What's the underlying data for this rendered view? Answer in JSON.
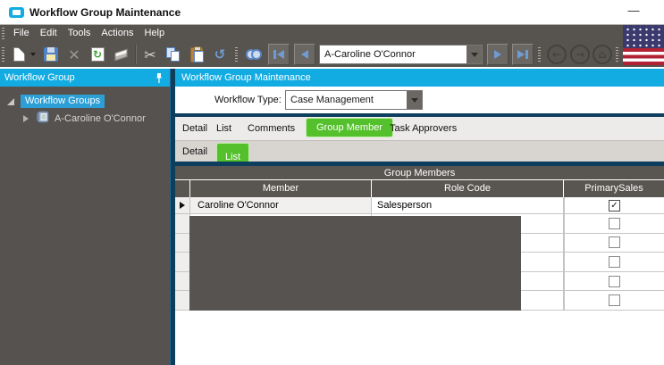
{
  "colors": {
    "accent_cyan": "#12ACE3",
    "selected_green": "#54C02B",
    "bar_dark_gray": "#57534E",
    "panel_dark_gray": "#555250",
    "splitter_navy": "#0E3E5E",
    "grid_header_gray": "#595551",
    "flag_blue": "#3A3A6E",
    "flag_red": "#B22234"
  },
  "window": {
    "title": "Workflow Group Maintenance",
    "minimize_glyph": "—"
  },
  "menu_bar": {
    "items": [
      "File",
      "Edit",
      "Tools",
      "Actions",
      "Help"
    ]
  },
  "toolbar": {
    "record_combo_value": "A-Caroline O'Connor",
    "icons": [
      "new-icon",
      "new-dropdown-icon",
      "save-icon",
      "delete-icon",
      "refresh-icon",
      "erase-icon",
      "cut-icon",
      "copy-icon",
      "paste-icon",
      "undo-icon",
      "find-icon",
      "first-record-icon",
      "previous-record-icon",
      "next-record-icon",
      "last-record-icon",
      "back-icon",
      "forward-icon",
      "home-icon",
      "us-flag-icon"
    ],
    "back_glyph": "←",
    "forward_glyph": "→",
    "home_glyph": "⌂",
    "refresh_glyph": "↻",
    "undo_glyph": "↺",
    "delete_glyph": "✕",
    "cut_glyph": "✂"
  },
  "left_panel": {
    "header": "Workflow Group",
    "icons": [
      "pin-icon",
      "expand-arrow-icon",
      "collapse-arrow-icon",
      "workflow-group-icon"
    ],
    "tree": {
      "root_label": "Workflow Groups",
      "child_label": "A-Caroline O'Connor"
    }
  },
  "main": {
    "header": "Workflow Group Maintenance",
    "workflow_type": {
      "label": "Workflow Type:",
      "value": "Case Management"
    },
    "tabs_row1": {
      "items": [
        "Detail",
        "List",
        "Comments",
        "Group Member",
        "Task Approvers"
      ],
      "active": "Group Member"
    },
    "tabs_row2": {
      "items": [
        "Detail",
        "List"
      ],
      "active": "List"
    },
    "grid": {
      "caption": "Group Members",
      "columns": [
        "Member",
        "Role Code",
        "PrimarySales"
      ],
      "rows": [
        {
          "member": "Caroline O'Connor",
          "role_code": "Salesperson",
          "primary_sales": true,
          "check_glyph": "✓"
        }
      ],
      "empty_row_count": 5
    }
  }
}
